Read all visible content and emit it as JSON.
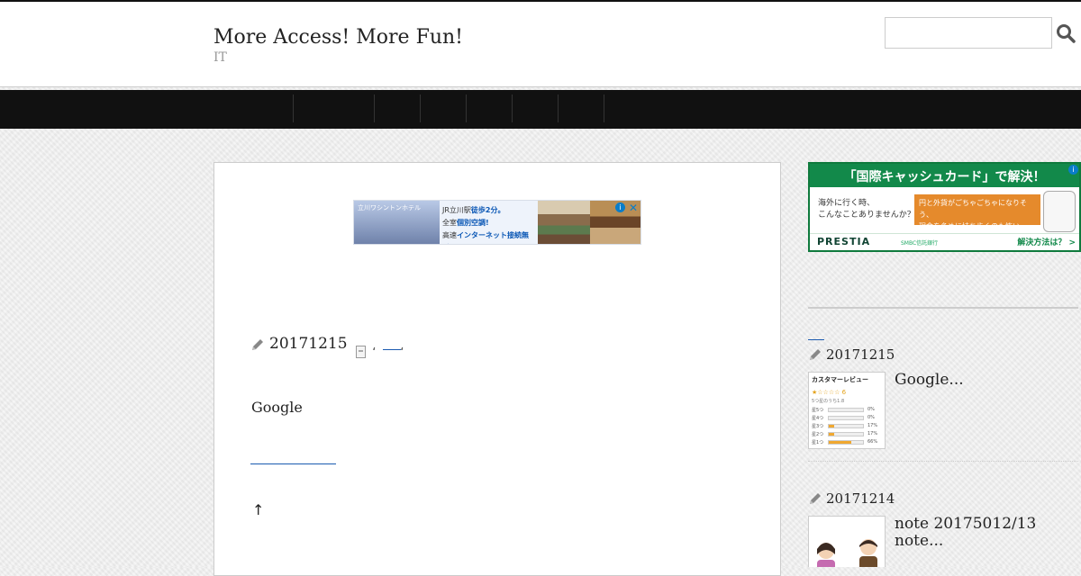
{
  "site": {
    "title": "More Access! More Fun!",
    "description": "IT"
  },
  "search": {
    "placeholder": "",
    "value": ""
  },
  "icons": {
    "search": "search-icon",
    "pencil": "pencil-icon",
    "category": "category-icon",
    "close": "close-icon",
    "info": "info-icon"
  },
  "nav": {
    "items": [
      "",
      "",
      "",
      "",
      "",
      ""
    ]
  },
  "ad_hotel": {
    "brand": "立川ワシントンホテル",
    "line1": "JR立川駅",
    "line1_hl": "徒歩2分。",
    "line2": "全室",
    "line2_hl": "個別空調!",
    "line3": "高速",
    "line3_hl": "インターネット接続無料!",
    "close": "✕",
    "info": "i"
  },
  "post": {
    "date": "20171215",
    "category_separator": "،",
    "category_separator2": "،",
    "body": "Google",
    "back_to_top": "↑"
  },
  "ad_card": {
    "headline": "「国際キャッシュカード」で解決！",
    "question_line1": "海外に行く時、",
    "question_line2": "こんなことありませんか？",
    "problem_line1": "円と外貨がごちゃごちゃになりそう、",
    "problem_line2": "現金を多めに持ち歩くのも怖い…",
    "brand": "PRESTIA",
    "brand_sub": "SMBC信託銀行",
    "cta": "解決方法は？ >",
    "info": "i"
  },
  "sidebar": {
    "entries": [
      {
        "date": "20171215",
        "title": "Google...",
        "thumb": {
          "heading": "カスタマーレビュー",
          "stars": "★☆☆☆☆ 6",
          "sub": "5つ星のうち1.8",
          "rows": [
            {
              "label": "星5つ",
              "pct": 0,
              "text": "0%"
            },
            {
              "label": "星4つ",
              "pct": 0,
              "text": "0%"
            },
            {
              "label": "星3つ",
              "pct": 17,
              "text": "17%"
            },
            {
              "label": "星2つ",
              "pct": 17,
              "text": "17%"
            },
            {
              "label": "星1つ",
              "pct": 66,
              "text": "66%"
            }
          ]
        }
      },
      {
        "date": "20171214",
        "title_line1": "note 20175012/13",
        "title_line2": "note..."
      }
    ]
  },
  "colors": {
    "nav": "#111111",
    "link": "#1a5ab0",
    "ad_green": "#12894a",
    "ad_orange": "#e58a2c"
  }
}
